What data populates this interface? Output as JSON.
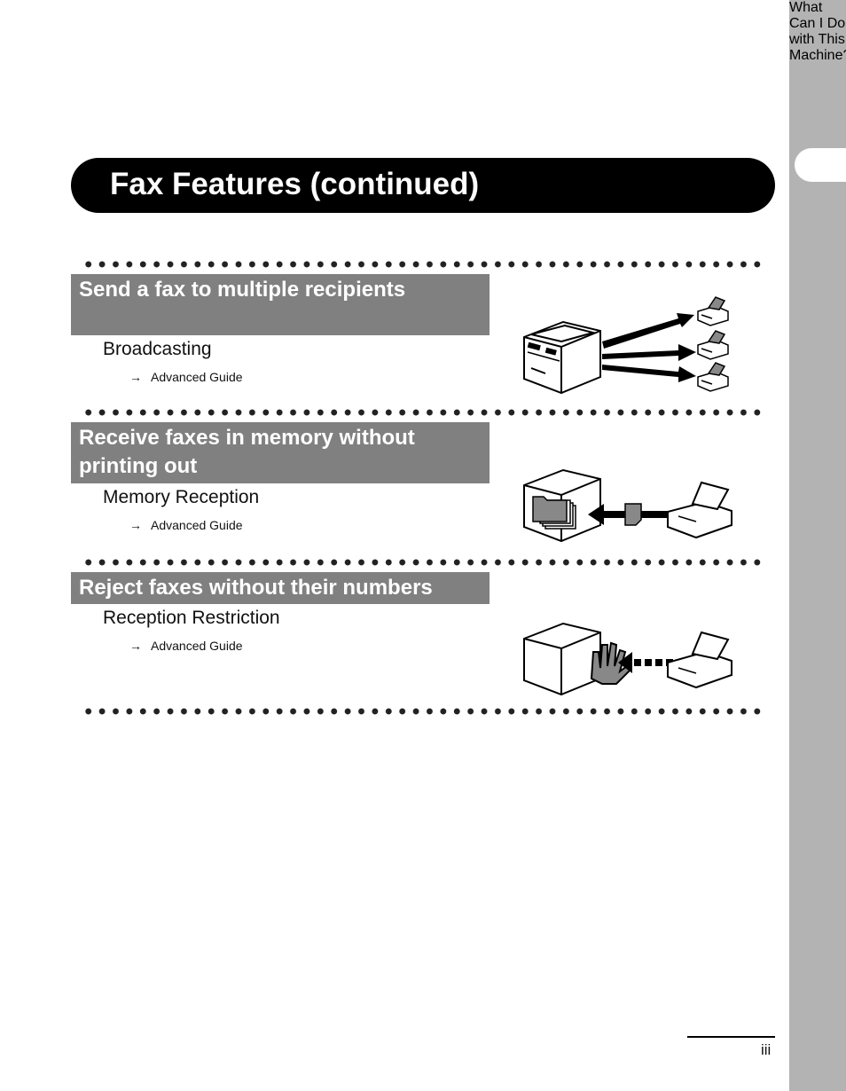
{
  "page": {
    "title": "Fax Features (continued)",
    "side_tab_label": "What Can I Do with This Machine?",
    "page_number": "iii"
  },
  "sections": [
    {
      "heading": "Send a fax to multiple recipients",
      "feature": "Broadcasting",
      "ref_arrow": "→",
      "ref": "Advanced Guide",
      "illustration": "machine-broadcasting-to-three-fax-machines"
    },
    {
      "heading": "Receive faxes in memory without printing out",
      "feature": "Memory Reception",
      "ref_arrow": "→",
      "ref": "Advanced Guide",
      "illustration": "fax-document-stored-in-machine-memory-folder"
    },
    {
      "heading": "Reject faxes without their numbers",
      "feature": "Reception Restriction",
      "ref_arrow": "→",
      "ref": "Advanced Guide",
      "illustration": "machine-hand-blocking-incoming-fax"
    }
  ]
}
